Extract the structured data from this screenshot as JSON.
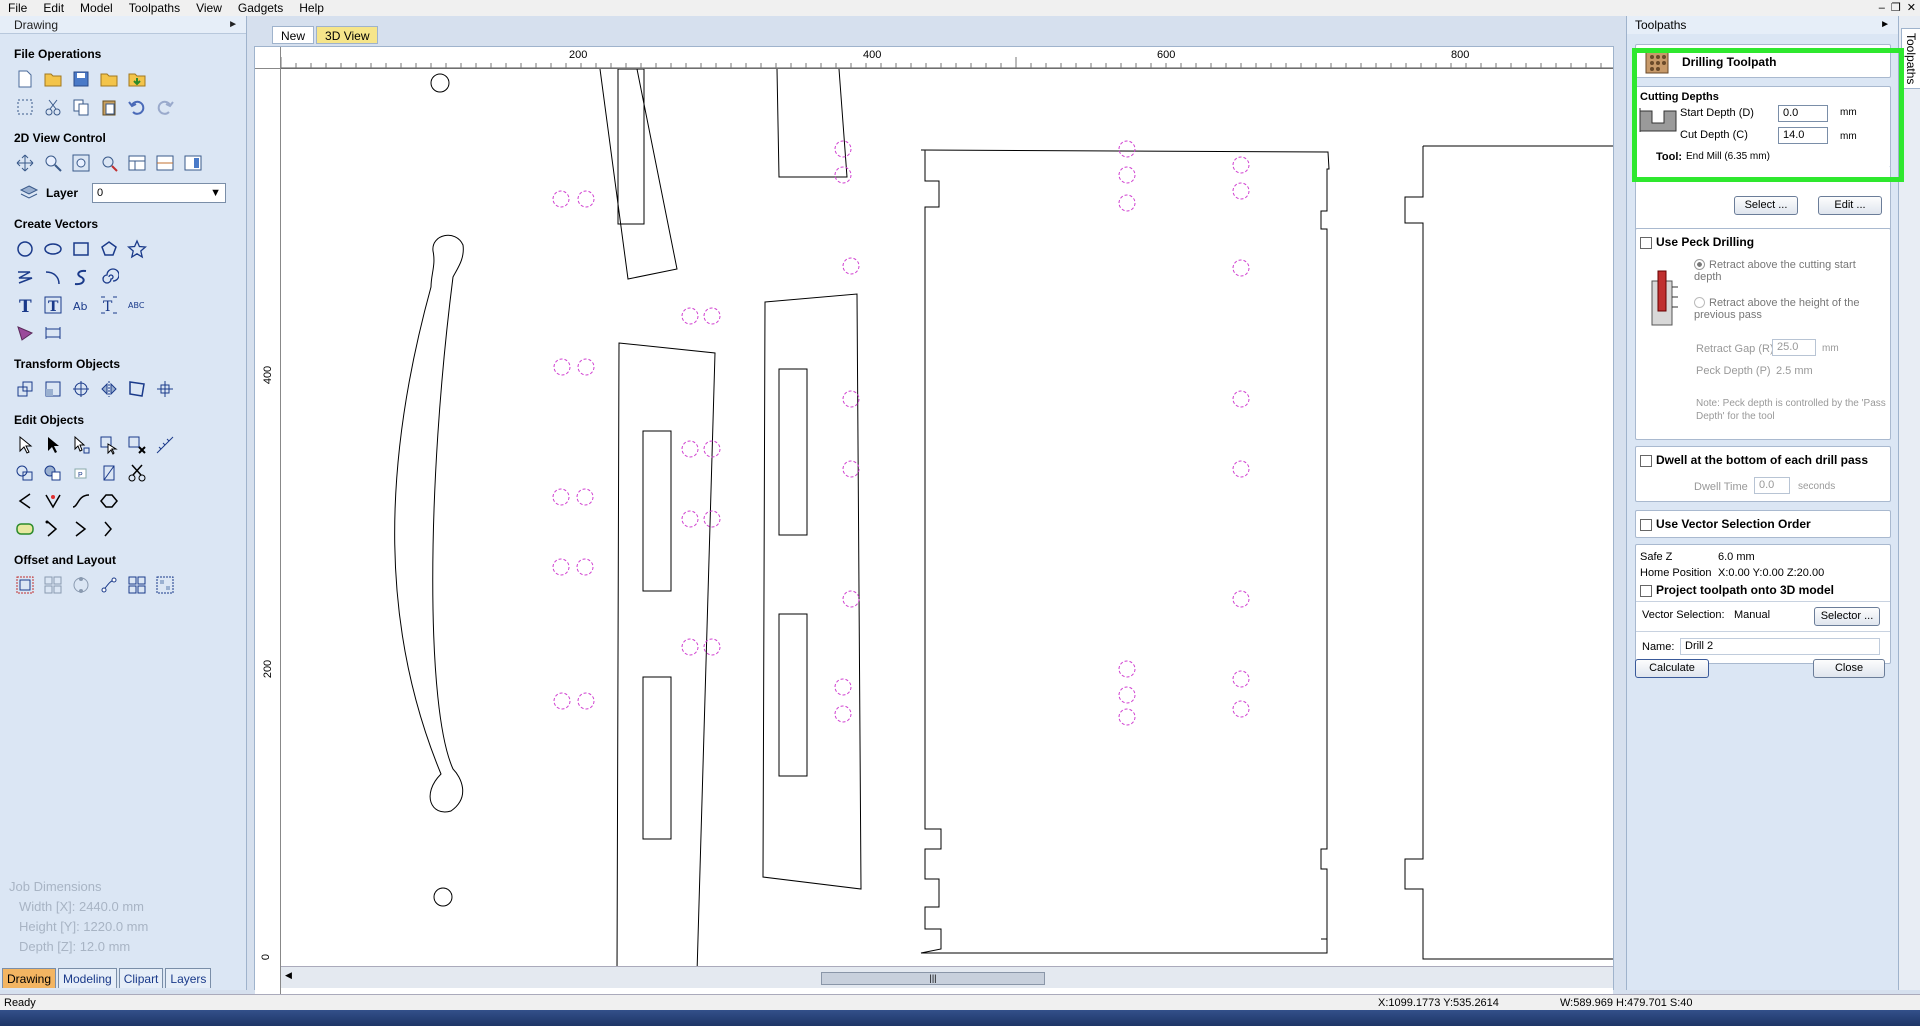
{
  "menu": [
    "File",
    "Edit",
    "Model",
    "Toolpaths",
    "View",
    "Gadgets",
    "Help"
  ],
  "left_panel": {
    "title": "Drawing",
    "sections": {
      "file_ops": "File Operations",
      "view_control": "2D View Control",
      "create_vectors": "Create Vectors",
      "transform": "Transform Objects",
      "edit_objects": "Edit Objects",
      "offset_layout": "Offset and Layout"
    },
    "layer_label": "Layer",
    "layer_value": "0",
    "job_dimensions": {
      "title": "Job Dimensions",
      "width": "Width  [X]: 2440.0 mm",
      "height": "Height [Y]: 1220.0 mm",
      "depth": "Depth  [Z]: 12.0 mm"
    },
    "tabs": [
      "Drawing",
      "Modeling",
      "Clipart",
      "Layers"
    ]
  },
  "doc_tabs": [
    "New",
    "3D View"
  ],
  "rulers": {
    "top": [
      "200",
      "400",
      "600",
      "800"
    ],
    "left": [
      "400",
      "200",
      "0"
    ]
  },
  "right_panel": {
    "title": "Toolpaths",
    "side_tab": "Toolpaths",
    "header": "Drilling Toolpath",
    "cutting_depths": {
      "title": "Cutting Depths",
      "start_label": "Start Depth (D)",
      "start_value": "0.0",
      "start_unit": "mm",
      "cut_label": "Cut Depth (C)",
      "cut_value": "14.0",
      "cut_unit": "mm"
    },
    "tool": {
      "label": "Tool:",
      "value": "End Mill (6.35 mm)",
      "select_btn": "Select ...",
      "edit_btn": "Edit ..."
    },
    "peck": {
      "title": "Use Peck Drilling",
      "opt1": "Retract above the cutting start depth",
      "opt2": "Retract above the height of the previous pass",
      "retract_label": "Retract Gap (R)",
      "retract_value": "25.0",
      "retract_unit": "mm",
      "peck_label": "Peck Depth (P)",
      "peck_value": "2.5 mm",
      "note": "Note: Peck depth is controlled by the 'Pass Depth' for the tool"
    },
    "dwell": {
      "title": "Dwell at the bottom of each drill pass",
      "label": "Dwell Time",
      "value": "0.0",
      "unit": "seconds"
    },
    "vector_order": "Use Vector Selection Order",
    "safe_z_label": "Safe Z",
    "safe_z_value": "6.0 mm",
    "home_label": "Home Position",
    "home_value": "X:0.00 Y:0.00 Z:20.00",
    "project": "Project toolpath onto 3D model",
    "vsel_label": "Vector Selection:",
    "vsel_value": "Manual",
    "selector_btn": "Selector ...",
    "name_label": "Name:",
    "name_value": "Drill 2",
    "calculate_btn": "Calculate",
    "close_btn": "Close"
  },
  "status": {
    "left": "Ready",
    "coords": "X:1099.1773 Y:535.2614",
    "dims": "W:589.969  H:479.701  S:40"
  },
  "colors": {
    "highlight": "#2ee82e",
    "drill_marks": "#d040d0",
    "active_tab": "#f3b562"
  }
}
